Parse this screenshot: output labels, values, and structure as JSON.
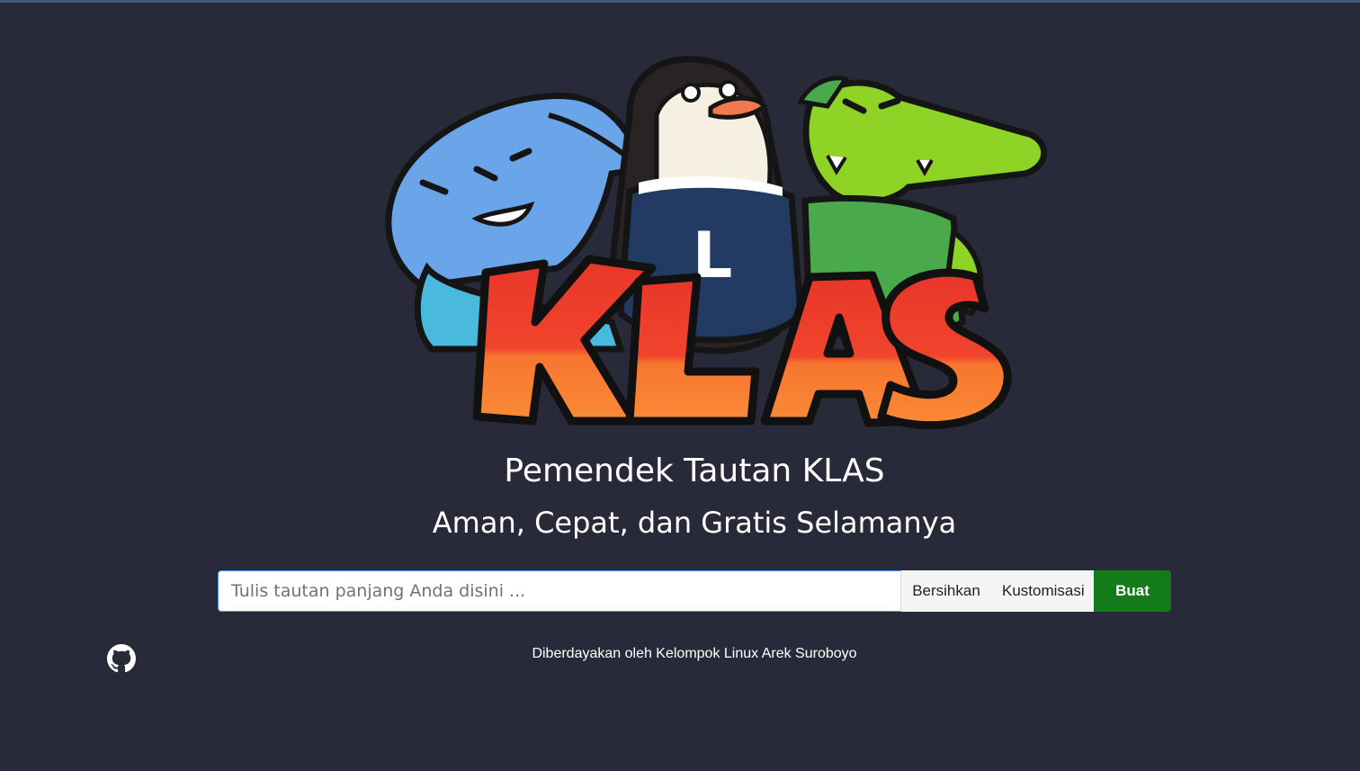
{
  "logo": {
    "wordmark": "KLAS",
    "mascot_letter": "L"
  },
  "header": {
    "title": "Pemendek Tautan KLAS",
    "subtitle": "Aman, Cepat, dan Gratis Selamanya"
  },
  "form": {
    "input_value": "",
    "input_placeholder": "Tulis tautan panjang Anda disini ...",
    "clear_label": "Bersihkan",
    "customize_label": "Kustomisasi",
    "create_label": "Buat"
  },
  "footer": {
    "powered_by": "Diberdayakan oleh Kelompok Linux Arek Suroboyo",
    "github_icon": "github-icon"
  },
  "colors": {
    "background": "#292a39",
    "create_button": "#157a1a",
    "input_focus_border": "#4d90fe"
  }
}
